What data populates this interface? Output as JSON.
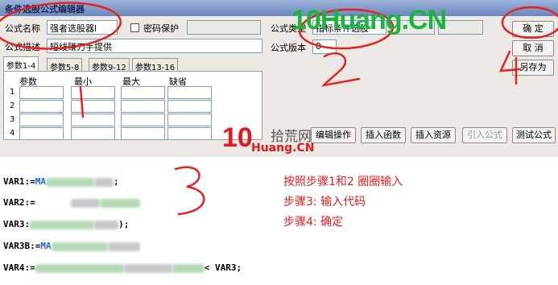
{
  "window": {
    "title": "条件选股公式编辑器"
  },
  "form": {
    "formula_name_label": "公式名称",
    "formula_name_value": "强者选股器l",
    "password_label": "密码保护",
    "password_checked": false,
    "description_label": "公式描述",
    "description_value": "短线赚刀手提供",
    "type_label": "公式类型",
    "type_value": "指标条件选股",
    "version_label": "公式版本",
    "version_value": "0"
  },
  "buttons": {
    "confirm": "确 定",
    "cancel": "取 消",
    "save_as": "另存为",
    "editor_ops": "编辑操作",
    "insert_function": "插入函数",
    "insert_resource": "插入资源",
    "import_formula": "引入公式",
    "test_formula": "测试公式"
  },
  "tabs": [
    {
      "label": "参数1-4",
      "active": true
    },
    {
      "label": "参数5-8",
      "active": false
    },
    {
      "label": "参数9-12",
      "active": false
    },
    {
      "label": "参数13-16",
      "active": false
    }
  ],
  "param_table": {
    "headers": [
      "参数",
      "最小",
      "最大",
      "缺省"
    ],
    "row_numbers": [
      "1",
      "2",
      "3",
      "4"
    ]
  },
  "code_lines": [
    {
      "prefix": "VAR1:=",
      "func": "MA",
      "suffix": ";"
    },
    {
      "prefix": "VAR2:=",
      "func": "",
      "suffix": ""
    },
    {
      "prefix": "VAR3:",
      "func": "",
      "suffix": ");"
    },
    {
      "prefix": "VAR3B:=",
      "func": "MA",
      "suffix": ""
    },
    {
      "prefix": "VAR4:=",
      "func": "",
      "suffix": "< VAR3;"
    }
  ],
  "annotations": {
    "note_line1": "按照步骤1和2  圈圈输入",
    "note_line2": "步骤3:  输入代码",
    "note_line3": "步骤4:  确定",
    "step_numbers": [
      "1",
      "2",
      "3",
      "4"
    ]
  },
  "watermarks": {
    "top_logo": "10Huang.CN",
    "center_logo_digits": "10",
    "center_site_name": "拾荒网",
    "center_url": "Huang.CN"
  },
  "colors": {
    "annotation_red": "#e02020",
    "watermark_green": "#18b540",
    "watermark_red": "#e5161d",
    "code_blue": "#1c64d8"
  }
}
